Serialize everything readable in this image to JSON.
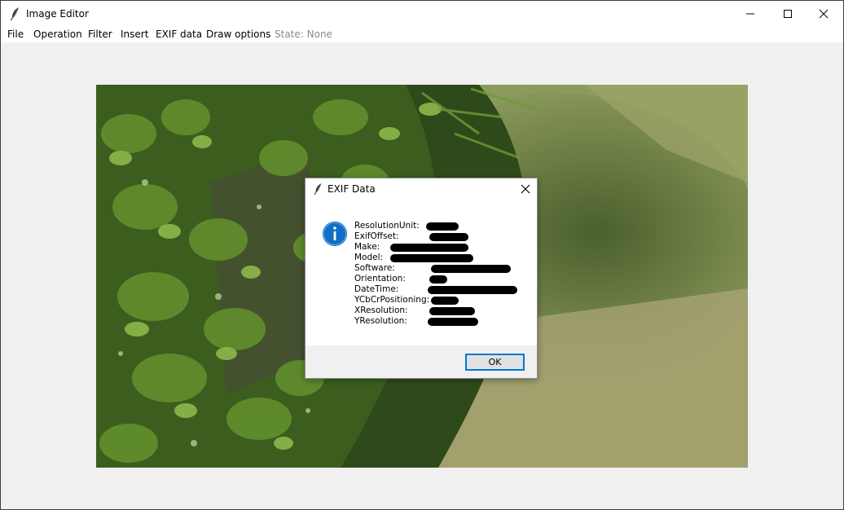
{
  "window": {
    "title": "Image Editor"
  },
  "menu": {
    "items": [
      "File",
      "Operation",
      "Filter",
      "Insert",
      "EXIF data",
      "Draw options"
    ],
    "state": "State: None"
  },
  "dialog": {
    "title": "EXIF Data",
    "fields": [
      "ResolutionUnit:",
      "ExifOffset:",
      "Make:",
      "Model:",
      "Software:",
      "Orientation:",
      "DateTime:",
      "YCbCrPositioning:",
      "XResolution:",
      "YResolution:"
    ],
    "ok_label": "OK"
  },
  "colors": {
    "accent": "#0078d7",
    "info_icon": "#0f6fc6"
  },
  "icons": {
    "app": "feather-icon",
    "info": "info-icon",
    "close": "close-icon"
  }
}
